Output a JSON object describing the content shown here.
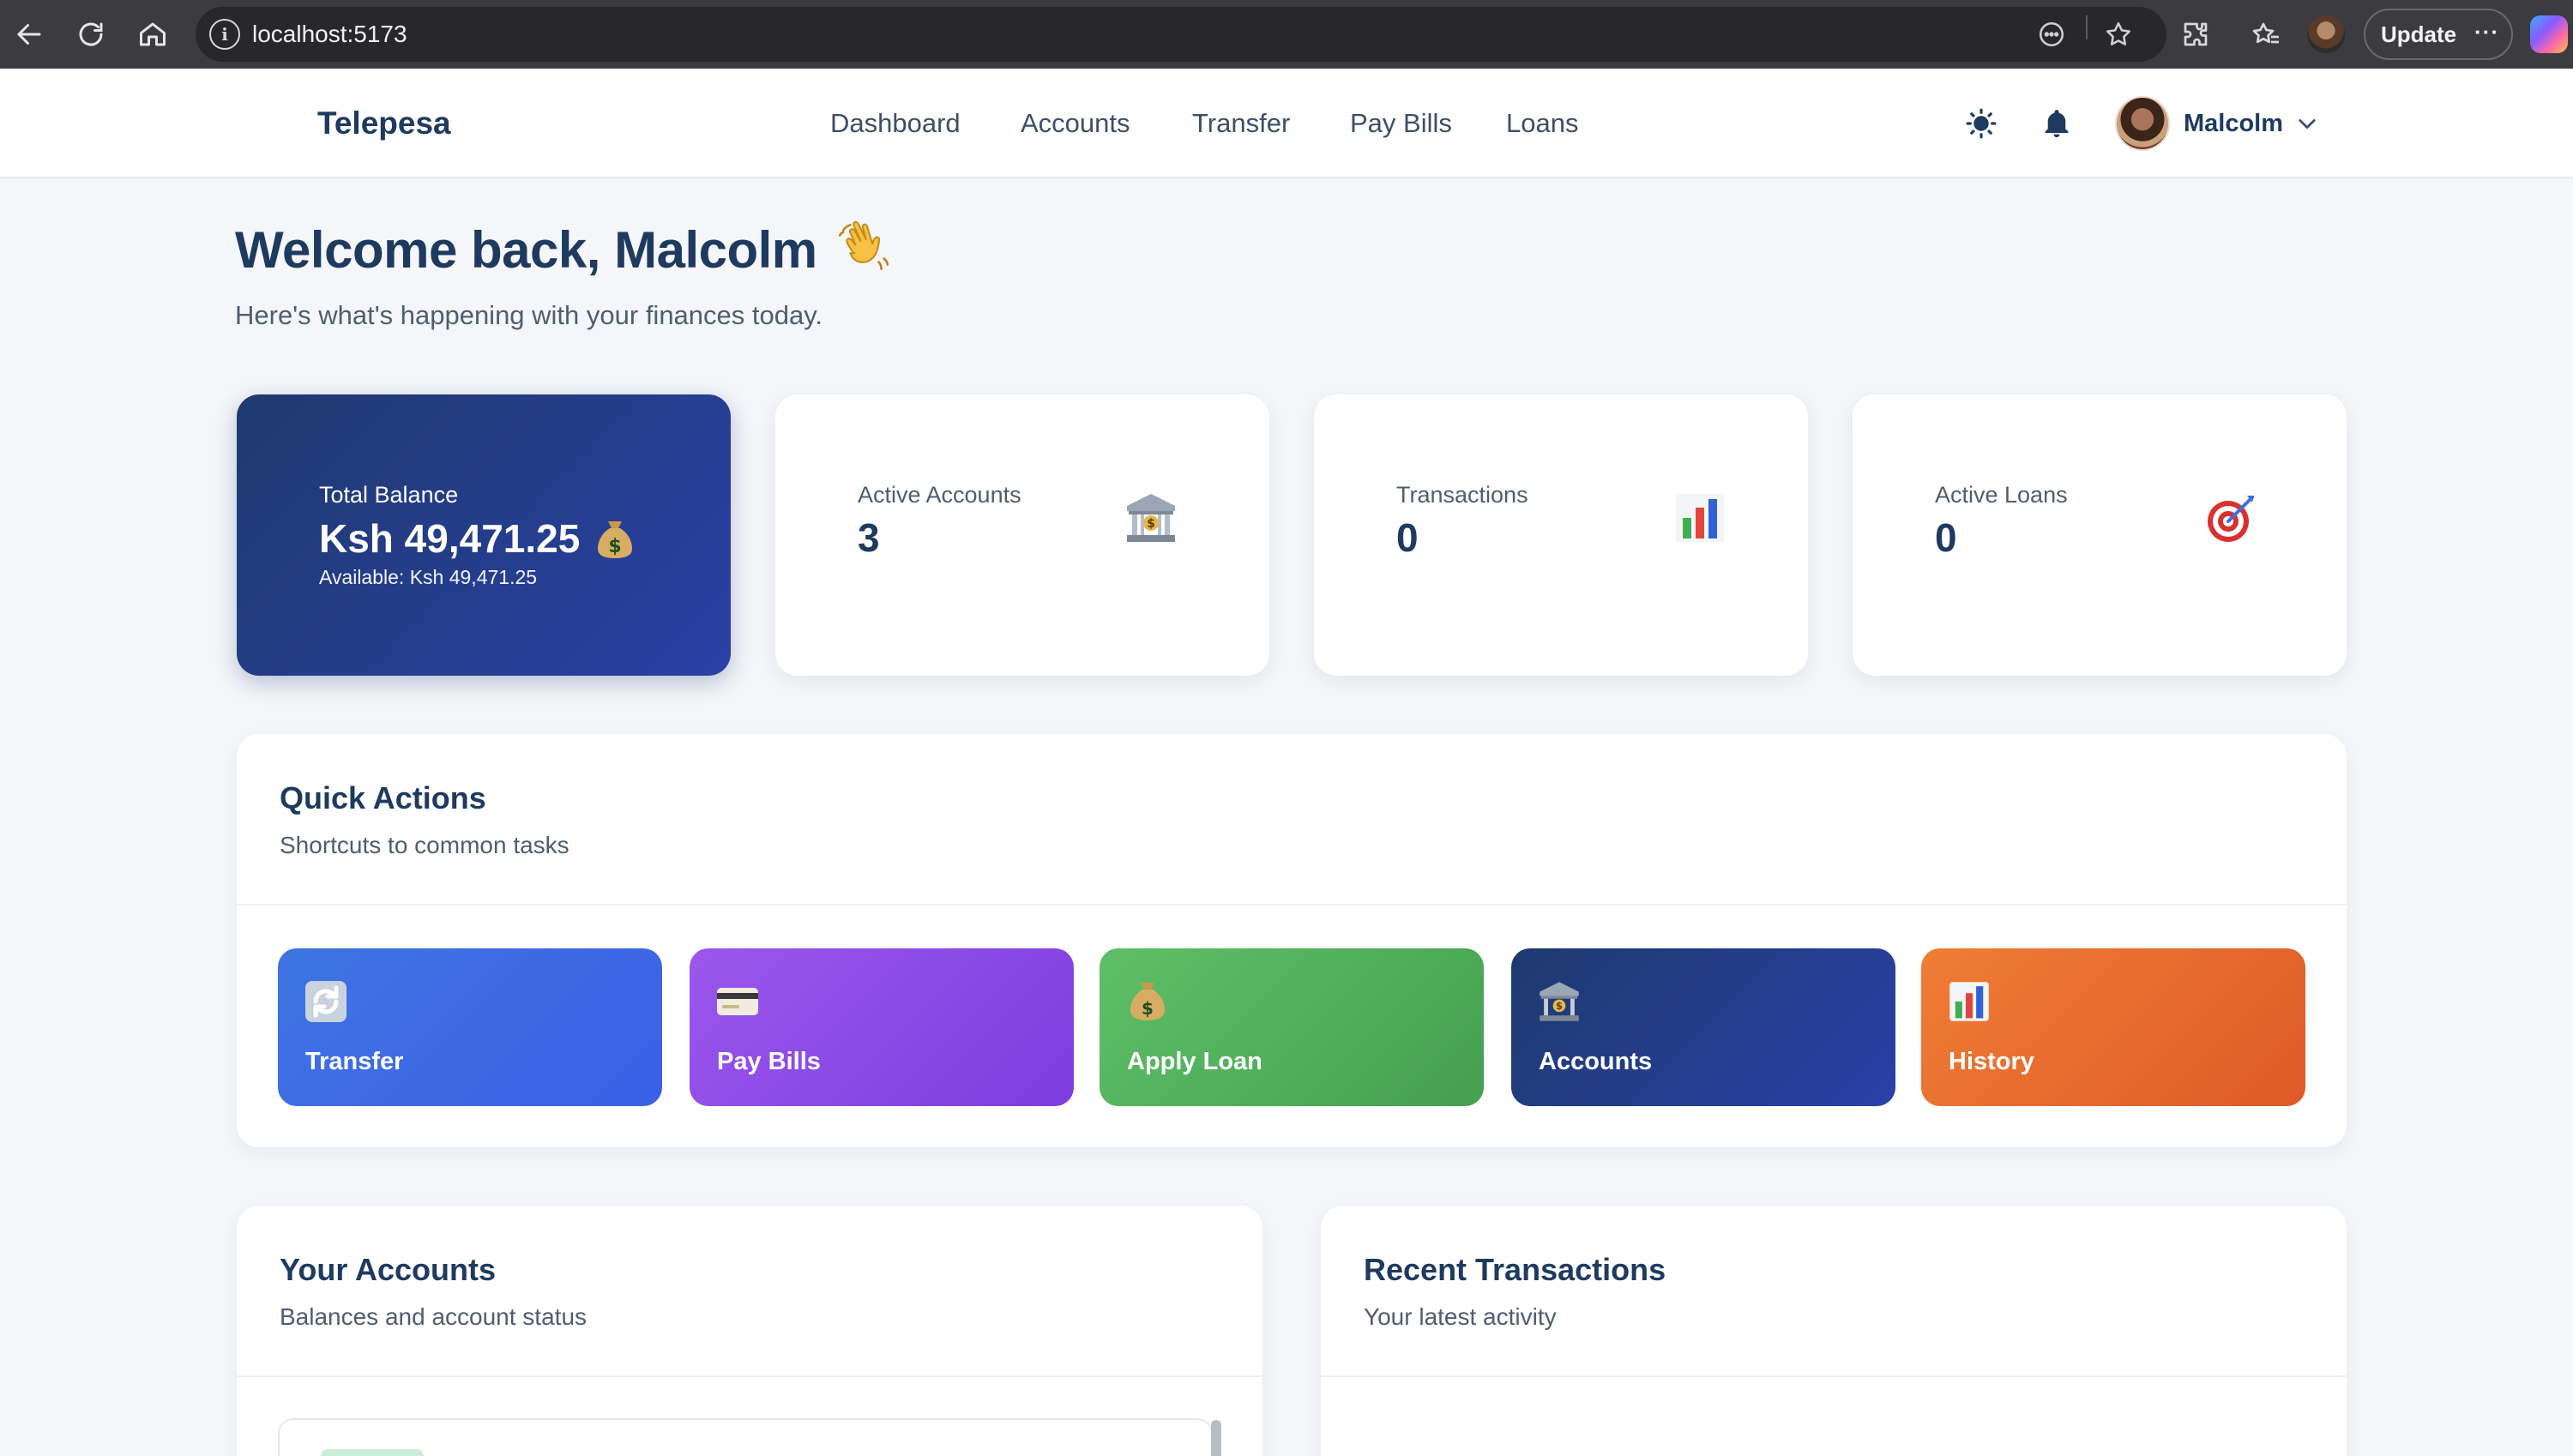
{
  "browser": {
    "url": "localhost:5173",
    "update_label": "Update",
    "more_label": "···"
  },
  "header": {
    "brand": "Telepesa",
    "nav": [
      "Dashboard",
      "Accounts",
      "Transfer",
      "Pay Bills",
      "Loans"
    ],
    "user_name": "Malcolm"
  },
  "welcome": {
    "title": "Welcome back, Malcolm",
    "subtitle": "Here's what's happening with your finances today."
  },
  "stats": {
    "balance": {
      "label": "Total Balance",
      "value": "Ksh 49,471.25",
      "available": "Available: Ksh 49,471.25",
      "icon": "money-bag-icon"
    },
    "accounts": {
      "label": "Active Accounts",
      "value": "3",
      "icon": "bank-icon"
    },
    "transactions": {
      "label": "Transactions",
      "value": "0",
      "icon": "bar-chart-icon"
    },
    "loans": {
      "label": "Active Loans",
      "value": "0",
      "icon": "target-icon"
    }
  },
  "quick_actions": {
    "title": "Quick Actions",
    "subtitle": "Shortcuts to common tasks",
    "items": [
      {
        "label": "Transfer",
        "icon": "refresh-icon",
        "color_from": "#3f6fe0",
        "color_to": "#3a62e6"
      },
      {
        "label": "Pay Bills",
        "icon": "credit-card-icon",
        "color_from": "#9a55ea",
        "color_to": "#7e3fe0"
      },
      {
        "label": "Apply Loan",
        "icon": "money-bag-icon",
        "color_from": "#5cbc66",
        "color_to": "#43a04f"
      },
      {
        "label": "Accounts",
        "icon": "bank-icon",
        "color_from": "#1e3a6e",
        "color_to": "#2a40a6"
      },
      {
        "label": "History",
        "icon": "bar-chart-icon",
        "color_from": "#ee7a35",
        "color_to": "#e05c28"
      }
    ]
  },
  "your_accounts": {
    "title": "Your Accounts",
    "subtitle": "Balances and account status"
  },
  "recent_transactions": {
    "title": "Recent Transactions",
    "subtitle": "Your latest activity"
  }
}
